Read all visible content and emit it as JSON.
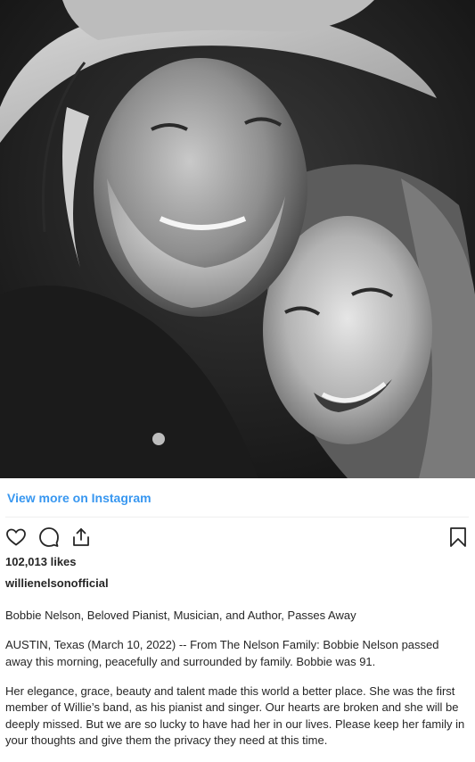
{
  "photo": {
    "alt": "Black and white photo of Willie Nelson and Bobbie Nelson"
  },
  "view_more_label": "View more on Instagram",
  "actions": {
    "like_icon": "heart-outline-icon",
    "comment_icon": "comment-bubble-icon",
    "share_icon": "share-upload-icon",
    "save_icon": "bookmark-icon"
  },
  "likes_text": "102,013 likes",
  "username": "willienelsonofficial",
  "caption": {
    "headline": "Bobbie Nelson, Beloved Pianist, Musician, and Author, Passes Away",
    "paragraph_1": "AUSTIN, Texas (March 10, 2022) -- From The Nelson Family: Bobbie Nelson passed away this morning, peacefully and surrounded by family. Bobbie was 91.",
    "paragraph_2": "Her elegance, grace, beauty and talent made this world a better place. She was the first member of Willie’s band, as his pianist and singer. Our hearts are broken and she will be deeply missed. But we are so lucky to have had her in our lives. Please keep her family in your thoughts and give them the privacy they need at this time."
  },
  "colors": {
    "link": "#3897f0",
    "text": "#262626",
    "divider": "#efefef"
  }
}
